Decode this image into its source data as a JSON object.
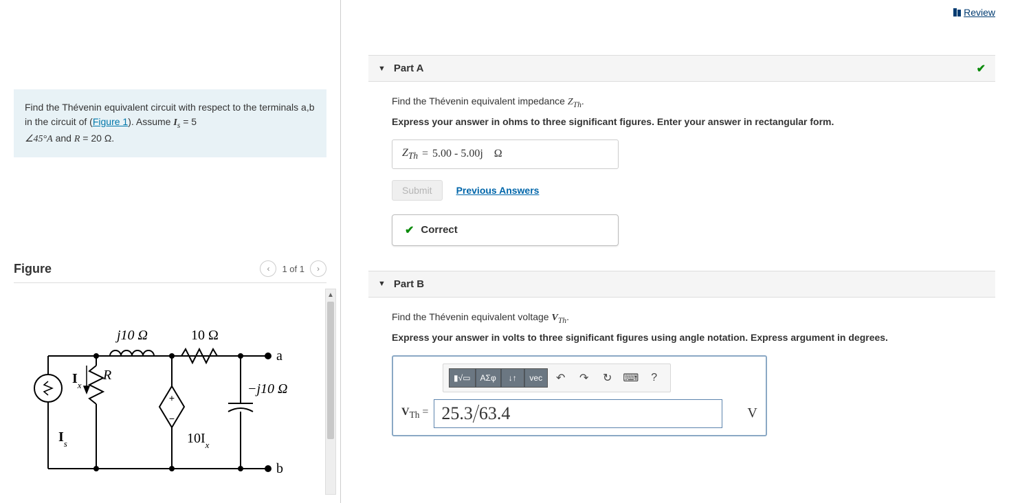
{
  "header": {
    "review": "Review"
  },
  "problem": {
    "line1": "Find the Thévenin equivalent circuit with respect to the terminals a,b in the circuit of (",
    "figure_link": "Figure 1",
    "line1_end": "). Assume ",
    "Is_label": "I",
    "Is_sub": "s",
    "Is_rest": " = 5 ",
    "angle_expr": "∠45°A",
    "and": " and ",
    "R_label": "R",
    "R_rest": " = 20 Ω."
  },
  "figure": {
    "title": "Figure",
    "pager": "1 of 1",
    "labels": {
      "j10": "j10 Ω",
      "r10": "10 Ω",
      "mj10": "−j10 Ω",
      "R": "R",
      "Ix": "I",
      "Ix_sub": "x",
      "Is": "I",
      "Is_sub": "s",
      "dep": "10I",
      "dep_sub": "x",
      "a": "a",
      "b": "b"
    }
  },
  "partA": {
    "title": "Part A",
    "instr_pre": "Find the Thévenin equivalent impedance ",
    "var": "Z",
    "var_sub": "Th",
    "instr_post": ".",
    "hint": "Express your answer in ohms to three significant figures. Enter your answer in rectangular form.",
    "ans_var": "Z",
    "ans_sub": "Th",
    "ans_val": "5.00 - 5.00j",
    "ans_unit": "Ω",
    "submit": "Submit",
    "prev": "Previous Answers",
    "correct": "Correct"
  },
  "partB": {
    "title": "Part B",
    "instr_pre": "Find the Thévenin equivalent voltage ",
    "var": "V",
    "var_sub": "Th",
    "instr_post": ".",
    "hint": "Express your answer in volts to three significant figures using angle notation. Express argument in degrees.",
    "toolbar": {
      "templates": "▮√▭",
      "greek": "ΑΣφ",
      "updown": "↓↑",
      "vec": "vec",
      "undo": "↶",
      "redo": "↷",
      "reset": "↻",
      "keyboard": "⌨",
      "help": "?"
    },
    "ans_var": "V",
    "ans_sub": "Th",
    "ans_mag": "25.3",
    "ans_ang": "63.4",
    "unit": "V"
  }
}
